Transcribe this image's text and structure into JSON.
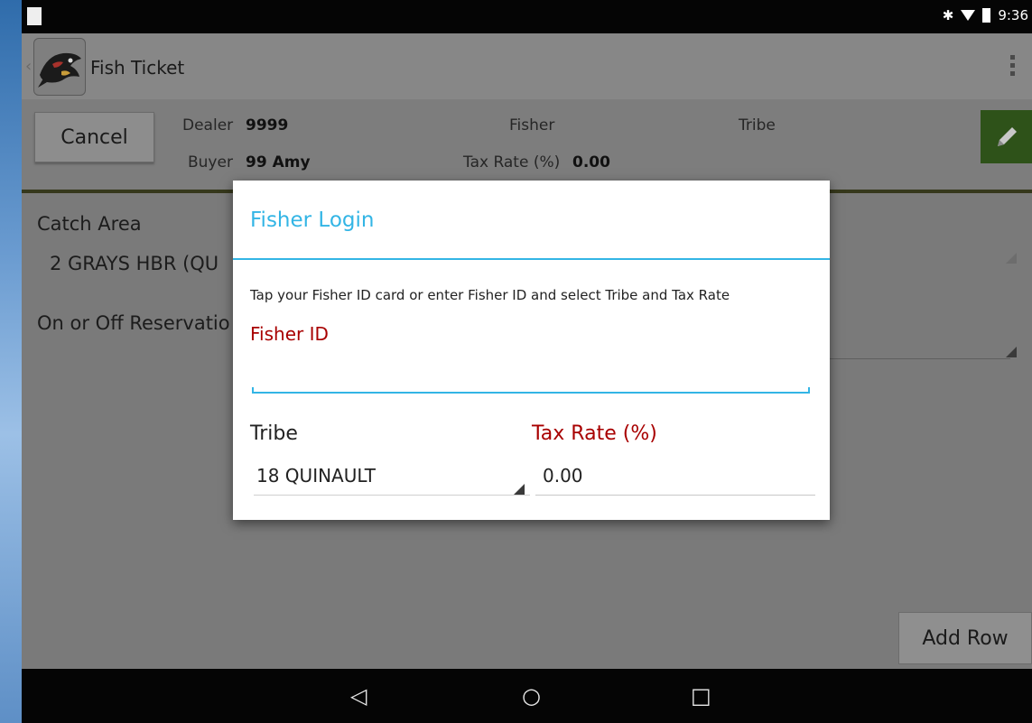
{
  "status_bar": {
    "time": "9:36",
    "bluetooth_glyph": "✱"
  },
  "app_bar": {
    "back_glyph": "‹",
    "title": "Fish Ticket"
  },
  "header": {
    "cancel_label": "Cancel",
    "dealer_label": "Dealer",
    "dealer_value": "9999",
    "buyer_label": "Buyer",
    "buyer_value": "99 Amy",
    "fisher_label": "Fisher",
    "tax_rate_label": "Tax Rate (%)",
    "tax_rate_value": "0.00",
    "tribe_label": "Tribe"
  },
  "form": {
    "catch_area_label": "Catch Area",
    "catch_area_value": "2  GRAYS HBR (QU",
    "reservation_label": "On or Off Reservatio"
  },
  "add_row_label": "Add Row",
  "nav_bar": {
    "back_glyph": "◁",
    "home_glyph": "○",
    "recents_glyph": "□"
  },
  "dialog": {
    "title": "Fisher Login",
    "instruction": "Tap your Fisher ID card or enter Fisher ID and select Tribe and Tax Rate",
    "fisher_id_label": "Fisher ID",
    "fisher_id_value": "",
    "tribe_label": "Tribe",
    "tribe_value": "18 QUINAULT",
    "tax_rate_label": "Tax Rate (%)",
    "tax_rate_value": "0.00"
  },
  "colors": {
    "accent": "#33b5e5",
    "required_label": "#a80000",
    "edit_button": "#2e5219",
    "header_rule": "#36381c"
  },
  "icons": [
    "app-logo-icon",
    "overflow-menu-icon",
    "pencil-icon",
    "wifi-icon",
    "battery-icon",
    "bluetooth-icon",
    "spinner-arrow-icon"
  ]
}
